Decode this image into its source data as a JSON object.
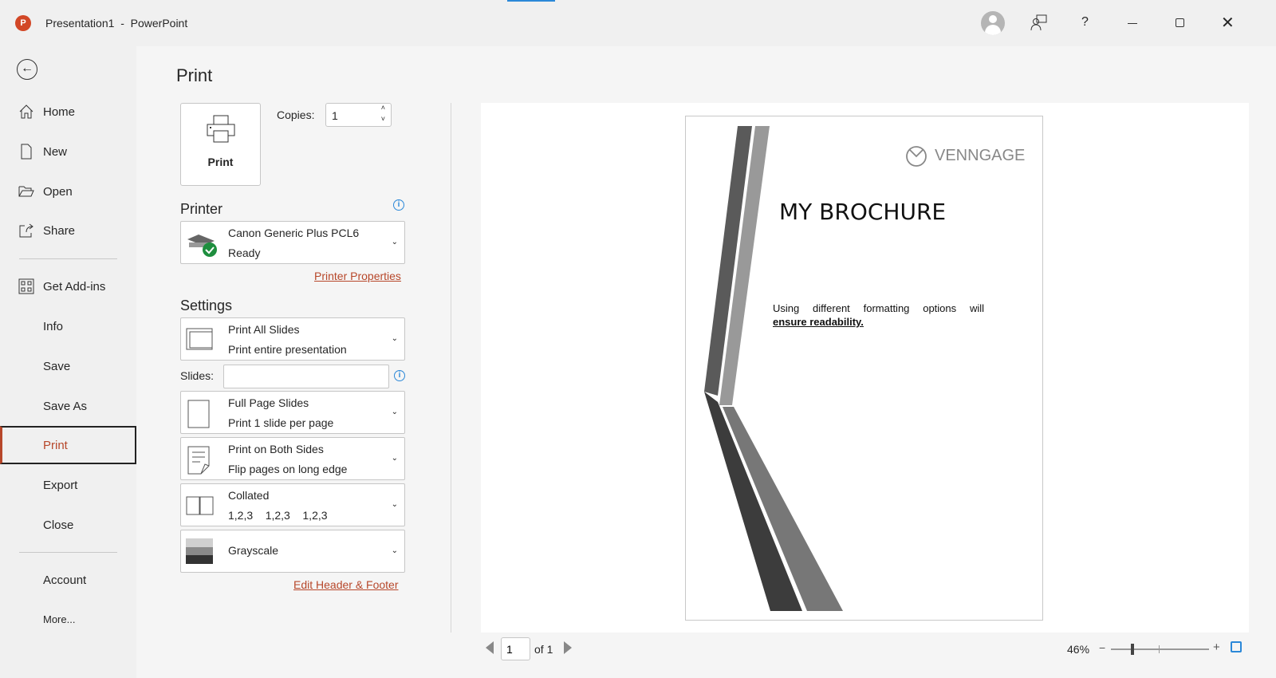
{
  "titlebar": {
    "doc": "Presentation1",
    "sep": "-",
    "app": "PowerPoint",
    "icons": [
      "account-avatar-icon",
      "feedback-icon",
      "help-icon",
      "minimize-icon",
      "restore-icon",
      "close-icon"
    ]
  },
  "nav": {
    "items": [
      {
        "label": "Home",
        "icon": "home-icon"
      },
      {
        "label": "New",
        "icon": "new-document-icon"
      },
      {
        "label": "Open",
        "icon": "folder-open-icon"
      },
      {
        "label": "Share",
        "icon": "share-icon"
      },
      {
        "label": "Get Add-ins",
        "icon": "add-ins-icon"
      },
      {
        "label": "Info"
      },
      {
        "label": "Save"
      },
      {
        "label": "Save As"
      },
      {
        "label": "Print",
        "selected": true
      },
      {
        "label": "Export"
      },
      {
        "label": "Close"
      },
      {
        "label": "Account"
      },
      {
        "label": "More..."
      }
    ]
  },
  "print": {
    "title": "Print",
    "button": "Print",
    "copies_label": "Copies:",
    "copies": "1",
    "printer_heading": "Printer",
    "printer_name": "Canon Generic Plus PCL6",
    "printer_status": "Ready",
    "printer_properties": "Printer Properties",
    "settings_heading": "Settings",
    "slides_label": "Slides:",
    "slides_value": "",
    "settings": [
      {
        "l1": "Print All Slides",
        "l2": "Print entire presentation"
      },
      {
        "l1": "Full Page Slides",
        "l2": "Print 1 slide per page"
      },
      {
        "l1": "Print on Both Sides",
        "l2": "Flip pages on long edge"
      },
      {
        "l1": "Collated",
        "l2": "1,2,3    1,2,3    1,2,3"
      },
      {
        "l1": "Grayscale",
        "l2": ""
      }
    ],
    "edit_header_footer": "Edit Header & Footer"
  },
  "preview": {
    "logo": "VENNGAGE",
    "title": "MY BROCHURE",
    "body_plain": "Using different formatting options will",
    "body_bold": "ensure readability.",
    "page": "1",
    "of": "of 1",
    "zoom": "46%",
    "zoom_fraction": 0.22
  },
  "colors": {
    "accent": "#b7472a",
    "info": "#2b88d8"
  }
}
